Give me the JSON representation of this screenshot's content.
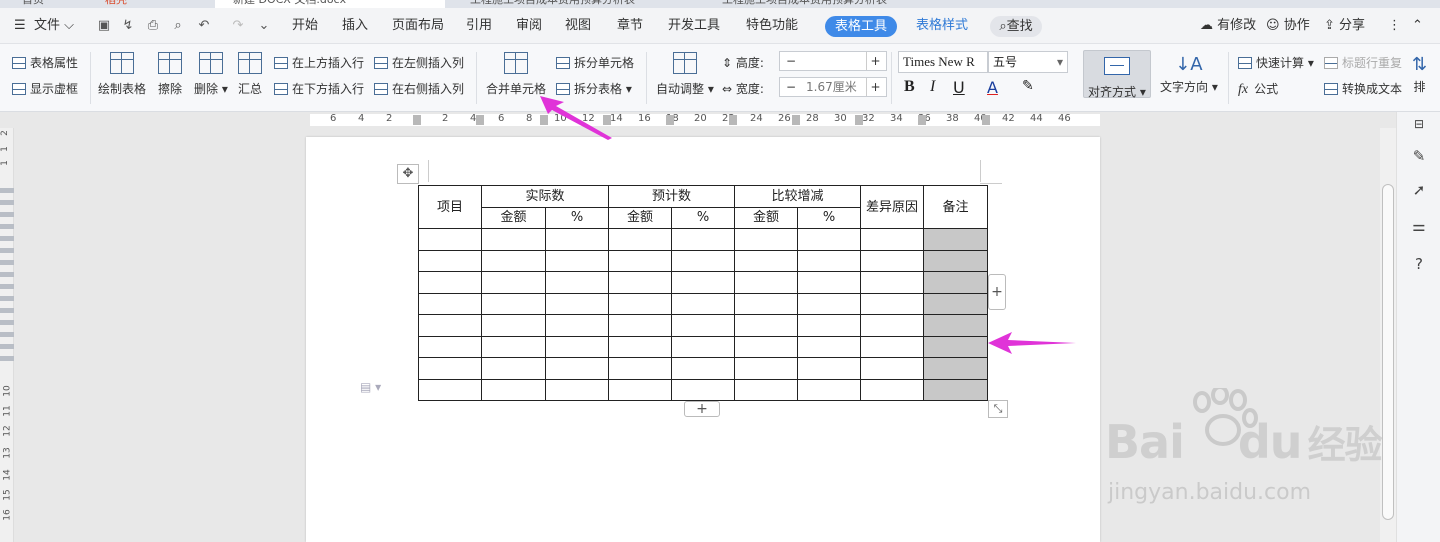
{
  "tabs": {
    "home": "首页",
    "app": "稻壳",
    "doc1": "新建 DOCX 文档.docx",
    "doc2": "工程施工项目成本费用预算分析表",
    "doc3": "工程施工项目成本费用预算分析表"
  },
  "menubar": {
    "file": "文件",
    "items": [
      "开始",
      "插入",
      "页面布局",
      "引用",
      "审阅",
      "视图",
      "章节",
      "开发工具",
      "特色功能"
    ],
    "table_tools": "表格工具",
    "table_style": "表格样式",
    "search": "查找",
    "changes": "有修改",
    "collab": "协作",
    "share": "分享"
  },
  "ribbon": {
    "table_props": "表格属性",
    "show_grid": "显示虚框",
    "draw_table": "绘制表格",
    "erase": "擦除",
    "delete": "删除",
    "summary": "汇总",
    "insert_above": "在上方插入行",
    "insert_below": "在下方插入行",
    "insert_left": "在左侧插入列",
    "insert_right": "在右侧插入列",
    "merge_cells": "合并单元格",
    "split_cells": "拆分单元格",
    "split_table": "拆分表格",
    "auto_fit": "自动调整",
    "height_label": "高度:",
    "height_value": "",
    "width_label": "宽度:",
    "width_value": "1.67厘米",
    "font_name": "Times New R",
    "font_size": "五号",
    "bold": "B",
    "italic": "I",
    "underline": "U",
    "font_color": "A",
    "align": "对齐方式",
    "text_direction": "文字方向",
    "quick_calc": "快速计算",
    "formula": "公式",
    "header_repeat": "标题行重复",
    "to_text": "转换成文本",
    "sort": "排"
  },
  "ruler": {
    "h_numbers": [
      "6",
      "4",
      "2",
      "2",
      "4",
      "6",
      "8",
      "10",
      "12",
      "14",
      "16",
      "18",
      "20",
      "22",
      "24",
      "26",
      "28",
      "30",
      "32",
      "34",
      "36",
      "38",
      "40",
      "42",
      "44",
      "46"
    ],
    "v_numbers": [
      "2",
      "1",
      "1",
      "10",
      "11",
      "12",
      "13",
      "14",
      "15",
      "16"
    ]
  },
  "table": {
    "h_item": "项目",
    "h_actual": "实际数",
    "h_budget": "预计数",
    "h_compare": "比较增减",
    "h_reason": "差异原因",
    "h_note": "备注",
    "amount": "金额",
    "pct": "%",
    "empty_rows": 8
  },
  "watermark": {
    "brand": "Bai",
    "brand2": "du",
    "brand_cn": "经验",
    "site": "jingyan.baidu.com"
  },
  "colors": {
    "accent": "#3f8ae8",
    "arrow": "#e033d8",
    "shade": "#c8c8c8"
  }
}
